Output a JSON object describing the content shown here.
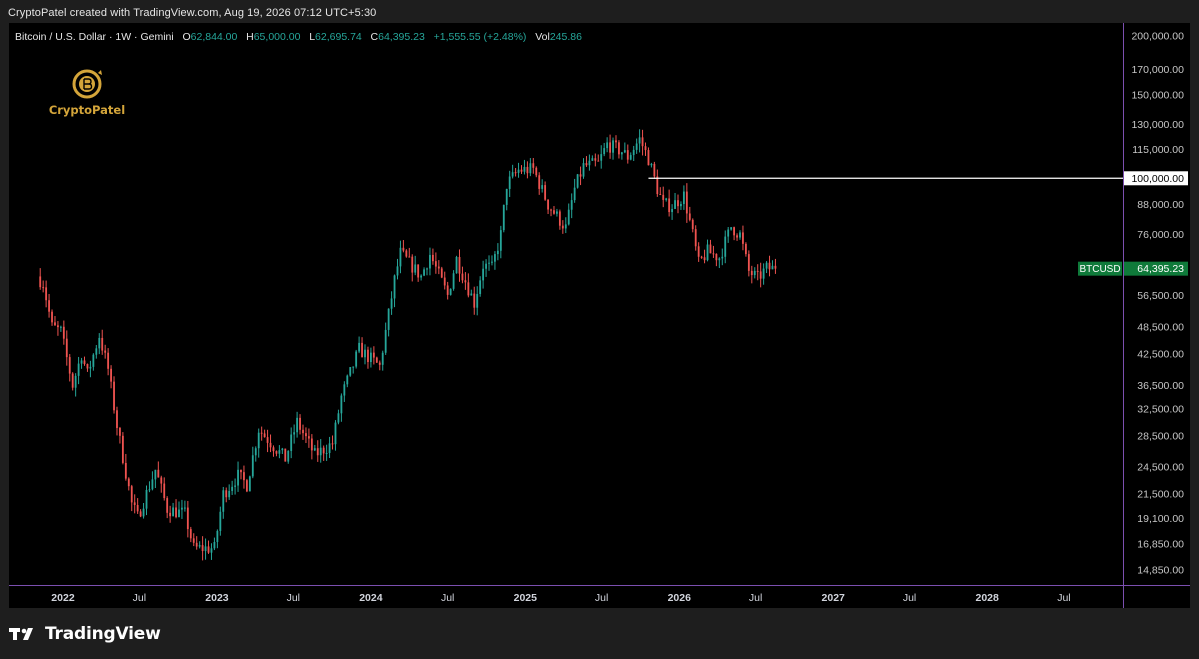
{
  "credit": "CryptoPatel created with TradingView.com, Aug 19, 2026 07:12 UTC+5:30",
  "legend": {
    "symbol": "Bitcoin / U.S. Dollar · 1W · Gemini",
    "o_label": "O",
    "o_value": "62,844.00",
    "h_label": "H",
    "h_value": "65,000.00",
    "l_label": "L",
    "l_value": "62,695.74",
    "c_label": "C",
    "c_value": "64,395.23",
    "change": "+1,555.55 (+2.48%)",
    "vol_label": "Vol",
    "vol_value": "245.86"
  },
  "logo": {
    "text": "CryptoPatel",
    "icon": "bitcoin-coin-icon"
  },
  "footer": {
    "brand": "TradingView",
    "icon": "tradingview-logo-icon"
  },
  "colors": {
    "up": "#26a69a",
    "down": "#ef5350",
    "background": "#000000",
    "frame": "#1e1e1e",
    "price_tag": "#0f7a3a",
    "level_line": "#ffffff",
    "axis_border": "#7b4fb0"
  },
  "chart_data": {
    "type": "candlestick",
    "title": "Bitcoin / U.S. Dollar · 1W · Gemini",
    "y_scale": "log",
    "ylim": [
      13800,
      213000
    ],
    "xlim": [
      "2021-08-26",
      "2028-11-18"
    ],
    "y_ticks": [
      {
        "value": 200000,
        "label": "200,000.00"
      },
      {
        "value": 170000,
        "label": "170,000.00"
      },
      {
        "value": 150000,
        "label": "150,000.00"
      },
      {
        "value": 130000,
        "label": "130,000.00"
      },
      {
        "value": 115000,
        "label": "115,000.00"
      },
      {
        "value": 88000,
        "label": "88,000.00"
      },
      {
        "value": 76000,
        "label": "76,000.00"
      },
      {
        "value": 56500,
        "label": "56,500.00"
      },
      {
        "value": 48500,
        "label": "48,500.00"
      },
      {
        "value": 42500,
        "label": "42,500.00"
      },
      {
        "value": 36500,
        "label": "36,500.00"
      },
      {
        "value": 32500,
        "label": "32,500.00"
      },
      {
        "value": 28500,
        "label": "28,500.00"
      },
      {
        "value": 24500,
        "label": "24,500.00"
      },
      {
        "value": 21500,
        "label": "21,500.00"
      },
      {
        "value": 19100,
        "label": "19,100.00"
      },
      {
        "value": 16850,
        "label": "16,850.00"
      },
      {
        "value": 14850,
        "label": "14,850.00"
      }
    ],
    "x_ticks": [
      {
        "date": "2022-01-01",
        "label": "2022",
        "bold": true
      },
      {
        "date": "2022-07-01",
        "label": "Jul",
        "bold": false
      },
      {
        "date": "2023-01-01",
        "label": "2023",
        "bold": true
      },
      {
        "date": "2023-07-01",
        "label": "Jul",
        "bold": false
      },
      {
        "date": "2024-01-01",
        "label": "2024",
        "bold": true
      },
      {
        "date": "2024-07-01",
        "label": "Jul",
        "bold": false
      },
      {
        "date": "2025-01-01",
        "label": "2025",
        "bold": true
      },
      {
        "date": "2025-07-01",
        "label": "Jul",
        "bold": false
      },
      {
        "date": "2026-01-01",
        "label": "2026",
        "bold": true
      },
      {
        "date": "2026-07-01",
        "label": "Jul",
        "bold": false
      },
      {
        "date": "2027-01-01",
        "label": "2027",
        "bold": true
      },
      {
        "date": "2027-07-01",
        "label": "Jul",
        "bold": false
      },
      {
        "date": "2028-01-01",
        "label": "2028",
        "bold": true
      },
      {
        "date": "2028-07-01",
        "label": "Jul",
        "bold": false
      }
    ],
    "horizontal_line": {
      "value": 100000,
      "start_date": "2025-10-20",
      "label": "100,000.00"
    },
    "last_price": {
      "value": 64395.23,
      "label": "64,395.23",
      "symbol": "BTCUSD"
    },
    "candles_start": "2021-11-01",
    "candle_interval": "1W",
    "close_path": [
      [
        "2021-11-01",
        62000
      ],
      [
        "2021-11-15",
        60000
      ],
      [
        "2021-12-06",
        48500
      ],
      [
        "2021-12-27",
        47500
      ],
      [
        "2022-01-24",
        36500
      ],
      [
        "2022-02-14",
        42500
      ],
      [
        "2022-02-28",
        38500
      ],
      [
        "2022-03-28",
        46500
      ],
      [
        "2022-04-18",
        39500
      ],
      [
        "2022-05-09",
        30000
      ],
      [
        "2022-06-13",
        20500
      ],
      [
        "2022-06-27",
        19200
      ],
      [
        "2022-08-08",
        24200
      ],
      [
        "2022-09-05",
        20000
      ],
      [
        "2022-10-17",
        19500
      ],
      [
        "2022-11-07",
        16500
      ],
      [
        "2022-12-26",
        16500
      ],
      [
        "2023-01-16",
        21500
      ],
      [
        "2023-02-20",
        23500
      ],
      [
        "2023-03-13",
        22500
      ],
      [
        "2023-04-10",
        29500
      ],
      [
        "2023-06-12",
        25500
      ],
      [
        "2023-07-10",
        30500
      ],
      [
        "2023-08-21",
        26000
      ],
      [
        "2023-10-02",
        27500
      ],
      [
        "2023-10-23",
        34500
      ],
      [
        "2023-12-04",
        43500
      ],
      [
        "2024-01-22",
        40000
      ],
      [
        "2024-02-26",
        61000
      ],
      [
        "2024-03-11",
        69500
      ],
      [
        "2024-04-29",
        62000
      ],
      [
        "2024-05-20",
        69000
      ],
      [
        "2024-07-01",
        56500
      ],
      [
        "2024-07-22",
        67500
      ],
      [
        "2024-09-02",
        54500
      ],
      [
        "2024-09-23",
        65500
      ],
      [
        "2024-10-14",
        64500
      ],
      [
        "2024-11-04",
        76000
      ],
      [
        "2024-11-18",
        97000
      ],
      [
        "2024-12-16",
        104000
      ],
      [
        "2025-01-20",
        104500
      ],
      [
        "2025-02-24",
        88000
      ],
      [
        "2025-04-07",
        78500
      ],
      [
        "2025-04-28",
        95000
      ],
      [
        "2025-05-19",
        106000
      ],
      [
        "2025-06-23",
        107500
      ],
      [
        "2025-07-14",
        118000
      ],
      [
        "2025-08-18",
        114000
      ],
      [
        "2025-09-01",
        111000
      ],
      [
        "2025-09-29",
        121000
      ],
      [
        "2025-10-20",
        110000
      ],
      [
        "2025-11-10",
        95000
      ],
      [
        "2025-11-24",
        88000
      ],
      [
        "2025-12-15",
        87500
      ],
      [
        "2026-01-12",
        92000
      ],
      [
        "2026-02-02",
        76000
      ],
      [
        "2026-02-16",
        66000
      ],
      [
        "2026-03-09",
        70000
      ],
      [
        "2026-04-06",
        68000
      ],
      [
        "2026-05-04",
        79000
      ],
      [
        "2026-05-25",
        76000
      ],
      [
        "2026-06-15",
        63500
      ],
      [
        "2026-07-06",
        61500
      ],
      [
        "2026-07-27",
        64500
      ],
      [
        "2026-08-17",
        64395.23
      ]
    ]
  }
}
